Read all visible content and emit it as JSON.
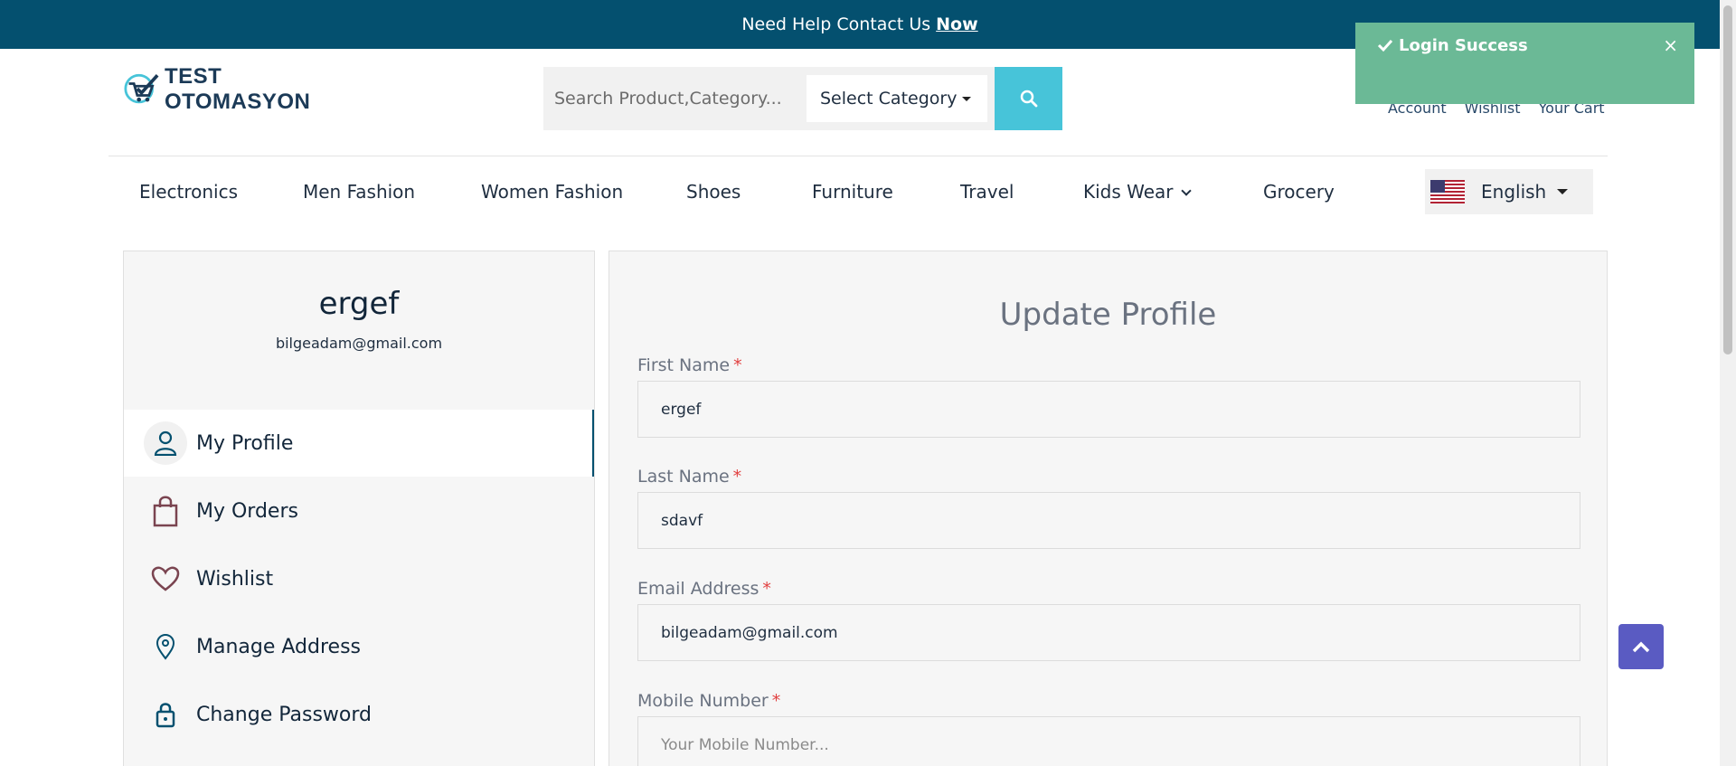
{
  "topbar": {
    "text": "Need Help Contact Us",
    "link": "Now"
  },
  "brand": {
    "name": "TEST OTOMASYON"
  },
  "search": {
    "placeholder": "Search Product,Category...",
    "category": "Select Category"
  },
  "header_links": [
    "Account",
    "Wishlist",
    "Your Cart"
  ],
  "nav": [
    "Electronics",
    "Men Fashion",
    "Women Fashion",
    "Shoes",
    "Furniture",
    "Travel",
    "Kids Wear",
    "Grocery"
  ],
  "language": {
    "label": "English"
  },
  "profile": {
    "name": "ergef",
    "email": "bilgeadam@gmail.com"
  },
  "sidebar": {
    "items": [
      {
        "label": "My Profile",
        "icon": "user-icon"
      },
      {
        "label": "My Orders",
        "icon": "shopping-bag-icon"
      },
      {
        "label": "Wishlist",
        "icon": "heart-icon"
      },
      {
        "label": "Manage Address",
        "icon": "location-pin-icon"
      },
      {
        "label": "Change Password",
        "icon": "lock-icon"
      }
    ]
  },
  "form": {
    "title": "Update Profile",
    "required_mark": "*",
    "first_name": {
      "label": "First Name",
      "value": "ergef"
    },
    "last_name": {
      "label": "Last Name",
      "value": "sdavf"
    },
    "email": {
      "label": "Email Address",
      "value": "bilgeadam@gmail.com"
    },
    "mobile": {
      "label": "Mobile Number",
      "placeholder": "Your Mobile Number..."
    }
  },
  "toast": {
    "text": "Login Success",
    "close": "×"
  },
  "colors": {
    "topbar": "#04506f",
    "search_button": "#47c4d9",
    "toast": "#6bb996",
    "back_to_top": "#5a5bc2",
    "required": "#e14040"
  }
}
